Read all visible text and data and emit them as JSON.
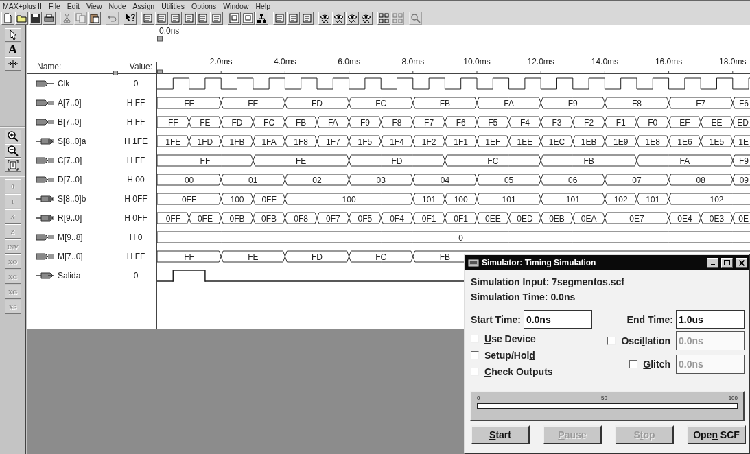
{
  "menu_bar": {
    "items": [
      "MAX+plus II",
      "File",
      "Edit",
      "View",
      "Node",
      "Assign",
      "Utilities",
      "Options",
      "Window",
      "Help"
    ]
  },
  "toolbar": {
    "groups": [
      [
        {
          "kind": "new",
          "disabled": false
        },
        {
          "kind": "open",
          "disabled": false
        },
        {
          "kind": "save",
          "disabled": false
        },
        {
          "kind": "print",
          "disabled": false
        }
      ],
      [
        {
          "kind": "cut",
          "disabled": true
        },
        {
          "kind": "copy",
          "disabled": true
        },
        {
          "kind": "paste",
          "disabled": false
        }
      ],
      [
        {
          "kind": "undo",
          "disabled": true
        }
      ],
      [
        {
          "kind": "help",
          "disabled": false
        }
      ],
      [
        {
          "kind": "tool",
          "disabled": false
        },
        {
          "kind": "tool",
          "disabled": false
        },
        {
          "kind": "tool",
          "disabled": false
        },
        {
          "kind": "tool",
          "disabled": false
        },
        {
          "kind": "tool",
          "disabled": false
        },
        {
          "kind": "tool",
          "disabled": false
        }
      ],
      [
        {
          "kind": "chart",
          "disabled": false
        },
        {
          "kind": "chart",
          "disabled": false
        },
        {
          "kind": "tree",
          "disabled": false
        }
      ],
      [
        {
          "kind": "tool",
          "disabled": false
        },
        {
          "kind": "tool",
          "disabled": false
        },
        {
          "kind": "tool",
          "disabled": false
        }
      ],
      [
        {
          "kind": "eye",
          "disabled": false
        },
        {
          "kind": "eye",
          "disabled": false
        },
        {
          "kind": "eye",
          "disabled": false
        },
        {
          "kind": "eye",
          "disabled": false
        }
      ],
      [
        {
          "kind": "grid",
          "disabled": false
        },
        {
          "kind": "grid",
          "disabled": true
        }
      ],
      [
        {
          "kind": "search",
          "disabled": true
        }
      ]
    ]
  },
  "side_toolbar": {
    "tools": [
      {
        "kind": "pointer"
      },
      {
        "kind": "text",
        "label": "A"
      },
      {
        "kind": "align"
      }
    ],
    "zoom": [
      {
        "kind": "zoom-in"
      },
      {
        "kind": "zoom-out"
      },
      {
        "kind": "fit"
      }
    ],
    "values": [
      {
        "label": "0",
        "disabled": true
      },
      {
        "label": "1",
        "disabled": true
      },
      {
        "label": "X",
        "disabled": true
      },
      {
        "label": "Z",
        "disabled": true
      },
      {
        "label": "INV",
        "disabled": true
      },
      {
        "label": "XO",
        "disabled": true
      },
      {
        "label": "XC",
        "disabled": true
      },
      {
        "label": "XG",
        "disabled": true
      },
      {
        "label": "XS",
        "disabled": true
      }
    ]
  },
  "waveform_editor": {
    "cursor_time": "0.0ns",
    "name_header": "Name:",
    "value_header": "Value:",
    "time_ticks": [
      "2.0ms",
      "4.0ms",
      "6.0ms",
      "8.0ms",
      "10.0ms",
      "12.0ms",
      "14.0ms",
      "16.0ms",
      "18.0ms"
    ],
    "signals": [
      {
        "name": "Clk",
        "value": "0",
        "input": true,
        "bus": false,
        "kind": "clock"
      },
      {
        "name": "A[7..0]",
        "value": "H FF",
        "input": true,
        "bus": true,
        "kind": "bus",
        "slots": [
          {
            "value": "FF",
            "hold": false
          },
          {
            "hold": true
          },
          {
            "value": "FE",
            "hold": false
          },
          {
            "hold": true
          },
          {
            "value": "FD",
            "hold": false
          },
          {
            "hold": true
          },
          {
            "value": "FC",
            "hold": false
          },
          {
            "hold": true
          },
          {
            "value": "FB",
            "hold": false
          },
          {
            "hold": true
          },
          {
            "value": "FA",
            "hold": false
          },
          {
            "hold": true
          },
          {
            "value": "F9",
            "hold": false
          },
          {
            "hold": true
          },
          {
            "value": "F8",
            "hold": false
          },
          {
            "hold": true
          },
          {
            "value": "F7",
            "hold": false
          },
          {
            "hold": true
          },
          {
            "value": "F6",
            "hold": false
          }
        ]
      },
      {
        "name": "B[7..0]",
        "value": "H FF",
        "input": true,
        "bus": true,
        "kind": "bus",
        "slots": [
          {
            "value": "FF",
            "hold": false
          },
          {
            "value": "FE",
            "hold": false
          },
          {
            "value": "FD",
            "hold": false
          },
          {
            "value": "FC",
            "hold": false
          },
          {
            "value": "FB",
            "hold": false
          },
          {
            "value": "FA",
            "hold": false
          },
          {
            "value": "F9",
            "hold": false
          },
          {
            "value": "F8",
            "hold": false
          },
          {
            "value": "F7",
            "hold": false
          },
          {
            "value": "F6",
            "hold": false
          },
          {
            "value": "F5",
            "hold": false
          },
          {
            "value": "F4",
            "hold": false
          },
          {
            "value": "F3",
            "hold": false
          },
          {
            "value": "F2",
            "hold": false
          },
          {
            "value": "F1",
            "hold": false
          },
          {
            "value": "F0",
            "hold": false
          },
          {
            "value": "EF",
            "hold": false
          },
          {
            "value": "EE",
            "hold": false
          },
          {
            "value": "ED",
            "hold": false
          }
        ]
      },
      {
        "name": "S[8..0]a",
        "value": "H 1FE",
        "input": false,
        "bus": true,
        "kind": "bus",
        "slots": [
          {
            "value": "1FE",
            "hold": false
          },
          {
            "value": "1FD",
            "hold": false
          },
          {
            "value": "1FB",
            "hold": false
          },
          {
            "value": "1FA",
            "hold": false
          },
          {
            "value": "1F8",
            "hold": false
          },
          {
            "value": "1F7",
            "hold": false
          },
          {
            "value": "1F5",
            "hold": false
          },
          {
            "value": "1F4",
            "hold": false
          },
          {
            "value": "1F2",
            "hold": false
          },
          {
            "value": "1F1",
            "hold": false
          },
          {
            "value": "1EF",
            "hold": false
          },
          {
            "value": "1EE",
            "hold": false
          },
          {
            "value": "1EC",
            "hold": false
          },
          {
            "value": "1EB",
            "hold": false
          },
          {
            "value": "1E9",
            "hold": false
          },
          {
            "value": "1E8",
            "hold": false
          },
          {
            "value": "1E6",
            "hold": false
          },
          {
            "value": "1E5",
            "hold": false
          },
          {
            "value": "1E",
            "hold": false
          }
        ]
      },
      {
        "name": "C[7..0]",
        "value": "H FF",
        "input": true,
        "bus": true,
        "kind": "bus",
        "slots": [
          {
            "value": "FF",
            "hold": false
          },
          {
            "hold": true
          },
          {
            "hold": true
          },
          {
            "value": "FE",
            "hold": false
          },
          {
            "hold": true
          },
          {
            "hold": true
          },
          {
            "value": "FD",
            "hold": false
          },
          {
            "hold": true
          },
          {
            "hold": true
          },
          {
            "value": "FC",
            "hold": false
          },
          {
            "hold": true
          },
          {
            "hold": true
          },
          {
            "value": "FB",
            "hold": false
          },
          {
            "hold": true
          },
          {
            "hold": true
          },
          {
            "value": "FA",
            "hold": false
          },
          {
            "hold": true
          },
          {
            "hold": true
          },
          {
            "value": "F9",
            "hold": false
          }
        ]
      },
      {
        "name": "D[7..0]",
        "value": "H 00",
        "input": true,
        "bus": true,
        "kind": "bus",
        "slots": [
          {
            "value": "00",
            "hold": false
          },
          {
            "hold": true
          },
          {
            "value": "01",
            "hold": false
          },
          {
            "hold": true
          },
          {
            "value": "02",
            "hold": false
          },
          {
            "hold": true
          },
          {
            "value": "03",
            "hold": false
          },
          {
            "hold": true
          },
          {
            "value": "04",
            "hold": false
          },
          {
            "hold": true
          },
          {
            "value": "05",
            "hold": false
          },
          {
            "hold": true
          },
          {
            "value": "06",
            "hold": false
          },
          {
            "hold": true
          },
          {
            "value": "07",
            "hold": false
          },
          {
            "hold": true
          },
          {
            "value": "08",
            "hold": false
          },
          {
            "hold": true
          },
          {
            "value": "09",
            "hold": false
          }
        ]
      },
      {
        "name": "S[8..0]b",
        "value": "H 0FF",
        "input": false,
        "bus": true,
        "kind": "bus",
        "slots": [
          {
            "value": "0FF",
            "hold": false
          },
          {
            "hold": true
          },
          {
            "value": "100",
            "hold": false
          },
          {
            "value": "0FF",
            "hold": false
          },
          {
            "value": "100",
            "hold": false
          },
          {
            "hold": true
          },
          {
            "hold": true
          },
          {
            "hold": true
          },
          {
            "value": "101",
            "hold": false
          },
          {
            "value": "100",
            "hold": false
          },
          {
            "value": "101",
            "hold": false
          },
          {
            "hold": true
          },
          {
            "value": "101",
            "hold": false
          },
          {
            "hold": true
          },
          {
            "value": "102",
            "hold": false
          },
          {
            "value": "101",
            "hold": false
          },
          {
            "value": "102",
            "hold": false
          },
          {
            "hold": true
          },
          {
            "hold": true
          }
        ]
      },
      {
        "name": "R[9..0]",
        "value": "H 0FF",
        "input": false,
        "bus": true,
        "kind": "bus",
        "slots": [
          {
            "value": "0FF",
            "hold": false
          },
          {
            "value": "0FE",
            "hold": false
          },
          {
            "value": "0FB",
            "hold": false
          },
          {
            "value": "0FB",
            "hold": false
          },
          {
            "value": "0F8",
            "hold": false
          },
          {
            "value": "0F7",
            "hold": false
          },
          {
            "value": "0F5",
            "hold": false
          },
          {
            "value": "0F4",
            "hold": false
          },
          {
            "value": "0F1",
            "hold": false
          },
          {
            "value": "0F1",
            "hold": false
          },
          {
            "value": "0EE",
            "hold": false
          },
          {
            "value": "0ED",
            "hold": false
          },
          {
            "value": "0EB",
            "hold": false
          },
          {
            "value": "0EA",
            "hold": false
          },
          {
            "value": "0E7",
            "hold": false
          },
          {
            "hold": true
          },
          {
            "value": "0E4",
            "hold": false
          },
          {
            "value": "0E3",
            "hold": false
          },
          {
            "value": "0E",
            "hold": false
          }
        ]
      },
      {
        "name": "M[9..8]",
        "value": "H 0",
        "input": true,
        "bus": true,
        "kind": "bus",
        "slots": [
          {
            "value": "0",
            "hold": false
          },
          {
            "hold": true
          },
          {
            "hold": true
          },
          {
            "hold": true
          },
          {
            "hold": true
          },
          {
            "hold": true
          },
          {
            "hold": true
          },
          {
            "hold": true
          },
          {
            "hold": true
          },
          {
            "hold": true
          },
          {
            "hold": true
          },
          {
            "hold": true
          },
          {
            "hold": true
          },
          {
            "hold": true
          },
          {
            "hold": true
          },
          {
            "hold": true
          },
          {
            "hold": true
          },
          {
            "hold": true
          },
          {
            "hold": true
          }
        ]
      },
      {
        "name": "M[7..0]",
        "value": "H FF",
        "input": true,
        "bus": true,
        "kind": "bus",
        "slots": [
          {
            "value": "FF",
            "hold": false
          },
          {
            "hold": true
          },
          {
            "value": "FE",
            "hold": false
          },
          {
            "hold": true
          },
          {
            "value": "FD",
            "hold": false
          },
          {
            "hold": true
          },
          {
            "value": "FC",
            "hold": false
          },
          {
            "hold": true
          },
          {
            "value": "FB",
            "hold": false
          },
          {
            "hold": true
          }
        ]
      },
      {
        "name": "Salida",
        "value": "0",
        "input": false,
        "bus": false,
        "kind": "bit",
        "slots": [
          {
            "high": false
          },
          {
            "high": true
          },
          {
            "high": true
          },
          {
            "high": false
          }
        ]
      }
    ]
  },
  "simulator_dialog": {
    "title": "Simulator: Timing Simulation",
    "input_line": "Simulation Input: 7segmentos.scf",
    "time_line": "Simulation Time: 0.0ns",
    "start_time": {
      "label": {
        "pre": "St",
        "key": "a",
        "post": "rt Time:"
      },
      "value": "0.0ns"
    },
    "end_time": {
      "label": {
        "key": "E",
        "post": "nd Time:"
      },
      "value": "1.0us"
    },
    "options": [
      {
        "label": {
          "key": "U",
          "post": "se Device"
        },
        "checked": false
      },
      {
        "label": {
          "pre": "Setup/Hol",
          "key": "d"
        },
        "checked": false
      },
      {
        "label": {
          "key": "C",
          "post": "heck Outputs"
        },
        "checked": false
      }
    ],
    "checks": [
      {
        "label": {
          "pre": "Osci",
          "key": "l",
          "post": "lation"
        },
        "checked": false,
        "value": "0.0ns"
      },
      {
        "label": {
          "key": "G",
          "post": "litch"
        },
        "checked": false,
        "value": "0.0ns"
      }
    ],
    "progress": {
      "scale": [
        "0",
        "50",
        "100"
      ],
      "level": 0
    },
    "buttons": [
      {
        "label": {
          "key": "S",
          "post": "tart"
        },
        "disabled": false
      },
      {
        "label": {
          "key": "P",
          "post": "ause"
        },
        "disabled": true
      },
      {
        "label": {
          "pre": "S",
          "key": "t",
          "post": "op"
        },
        "disabled": true
      },
      {
        "label": {
          "pre": "Ope",
          "key": "n",
          "post": " SCF"
        },
        "disabled": false
      }
    ]
  }
}
